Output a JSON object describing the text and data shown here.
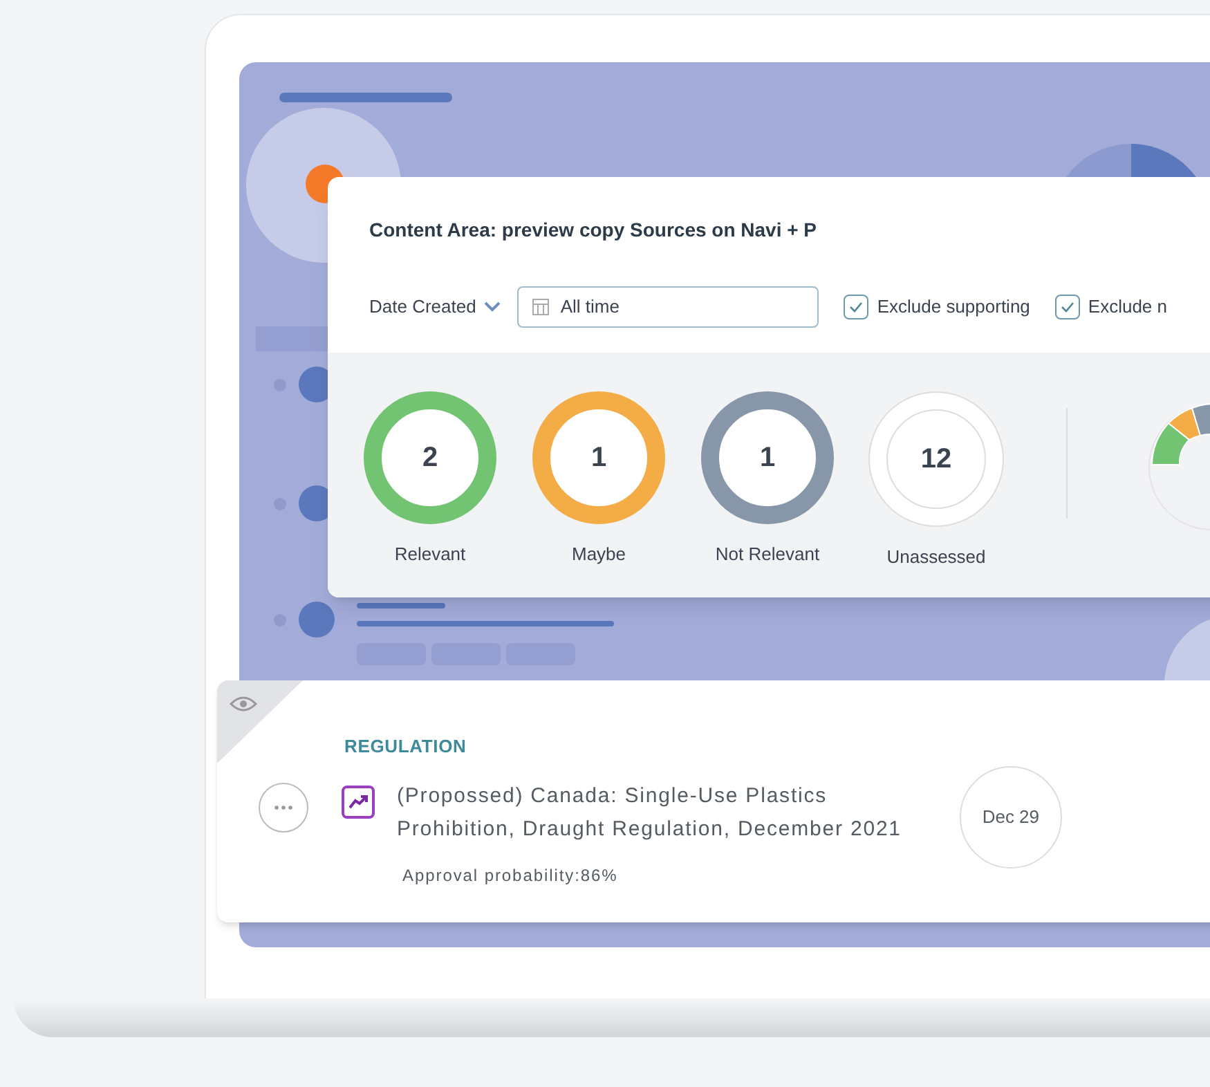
{
  "panel": {
    "title": "Content Area: preview copy Sources on Navi + P",
    "filter": {
      "label": "Date Created",
      "value": "All time"
    },
    "options": [
      {
        "label": "Exclude supporting",
        "checked": true
      },
      {
        "label": "Exclude n",
        "checked": true
      }
    ],
    "statuses": [
      {
        "count": "2",
        "label": "Relevant",
        "kind": "ring",
        "color": "#72c472"
      },
      {
        "count": "1",
        "label": "Maybe",
        "kind": "ring",
        "color": "#f3ac46"
      },
      {
        "count": "1",
        "label": "Not Relevant",
        "kind": "ring",
        "color": "#8796a8"
      },
      {
        "count": "12",
        "label": "Unassessed",
        "kind": "outline",
        "color": "#dddddd"
      }
    ]
  },
  "item": {
    "category": "REGULATION",
    "title_lines": [
      "(Propossed) Canada: Single-Use Plastics",
      "Prohibition, Draught Regulation, December 2021"
    ],
    "probability": "Approval probability:86%",
    "date": "Dec 29"
  }
}
